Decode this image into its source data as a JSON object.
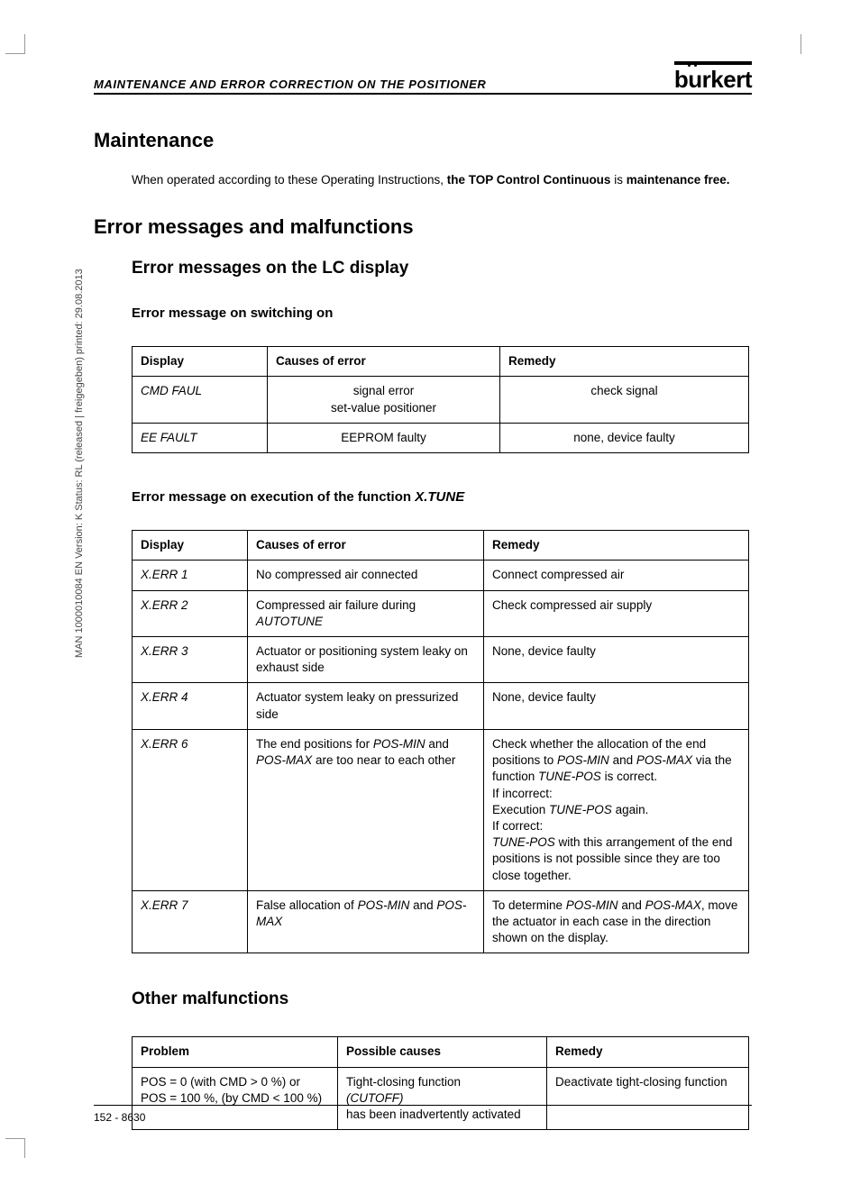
{
  "header": {
    "running_head": "MAINTENANCE AND ERROR CORRECTION ON THE POSITIONER",
    "logo": "burkert"
  },
  "side_text": "MAN 1000010084 EN Version: K Status: RL (released | freigegeben) printed: 29.08.2013",
  "footer": "152 - 8630",
  "s1": {
    "h1": "Maintenance",
    "p_a": "When operated according to these Operating Instructions, ",
    "p_b": "the TOP Control Continuous",
    "p_c": " is ",
    "p_d": "maintenance free."
  },
  "s2": {
    "h1": "Error messages and malfunctions",
    "h2": "Error messages on the LC display",
    "t1": {
      "h3": "Error message on switching on",
      "head": {
        "c1": "Display",
        "c2": "Causes of error",
        "c3": "Remedy"
      },
      "rows": [
        {
          "c1": "CMD FAUL",
          "c2": "signal error\nset-value positioner",
          "c3": "check signal"
        },
        {
          "c1": "EE FAULT",
          "c2": "EEPROM faulty",
          "c3": "none, device faulty"
        }
      ]
    },
    "t2": {
      "h3_a": "Error message on execution of the function ",
      "h3_b": "X.TUNE",
      "head": {
        "c1": "Display",
        "c2": "Causes of error",
        "c3": "Remedy"
      },
      "rows": [
        {
          "c1": "X.ERR 1",
          "c2": "No compressed air connected",
          "c3": "Connect compressed air"
        },
        {
          "c1": "X.ERR 2",
          "c2_a": "Compressed air failure during ",
          "c2_i": "AUTOTUNE",
          "c3": "Check compressed air supply"
        },
        {
          "c1": "X.ERR 3",
          "c2": "Actuator or positioning system leaky on exhaust side",
          "c3": "None, device faulty"
        },
        {
          "c1": "X.ERR 4",
          "c2": "Actuator system leaky on pressurized side",
          "c3": "None, device faulty"
        },
        {
          "c1": "X.ERR 6",
          "c2_a": "The end positions for ",
          "c2_i1": "POS-MIN",
          "c2_b": " and ",
          "c2_i2": "POS-MAX",
          "c2_c": " are too near to each other",
          "c3_a": "Check whether the allocation of the end positions to ",
          "c3_i1": "POS-MIN",
          "c3_b": " and ",
          "c3_i2": "POS-MAX",
          "c3_c": " via the function ",
          "c3_i3": "TUNE-POS",
          "c3_d": " is correct.",
          "c3_e": "If incorrect:",
          "c3_f": "Execution ",
          "c3_i4": "TUNE-POS",
          "c3_g": " again.",
          "c3_h": "If correct:",
          "c3_i5": "TUNE-POS",
          "c3_j": " with this arrangement of the end positions is not possible since they are too close together."
        },
        {
          "c1": "X.ERR 7",
          "c2_a": "False allocation of ",
          "c2_i1": "POS-MIN",
          "c2_b": " and ",
          "c2_i2": "POS-MAX",
          "c3_a": "To determine ",
          "c3_i1": "POS-MIN",
          "c3_b": " and ",
          "c3_i2": "POS-MAX",
          "c3_c": ", move the actuator in each case in the direction shown on the display."
        }
      ]
    },
    "t3": {
      "h2": "Other malfunctions",
      "head": {
        "c1": "Problem",
        "c2": "Possible causes",
        "c3": "Remedy"
      },
      "rows": [
        {
          "c1": "POS = 0 (with CMD > 0 %) or\nPOS = 100 %, (by CMD < 100 %)",
          "c2_a": "Tight-closing function",
          "c2_i": "(CUTOFF)",
          "c2_b": "has been inadvertently activated",
          "c3": "Deactivate tight-closing function"
        }
      ]
    }
  }
}
